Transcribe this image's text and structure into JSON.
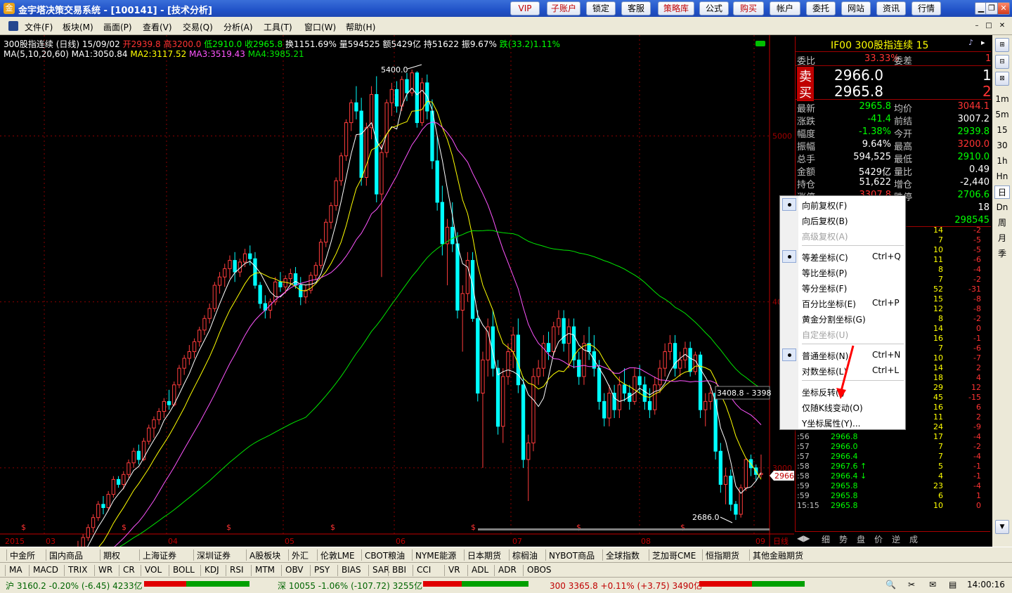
{
  "window": {
    "title": "金宇塔决策交易系统 - [100141] - [技术分析]",
    "title_buttons": [
      "VIP",
      "子账户",
      "锁定",
      "客服",
      "策略库",
      "公式",
      "购买",
      "帐户",
      "委托",
      "网站",
      "资讯",
      "行情"
    ]
  },
  "menubar": [
    "文件(F)",
    "板块(M)",
    "画面(P)",
    "查看(V)",
    "交易(Q)",
    "分析(A)",
    "工具(T)",
    "窗口(W)",
    "帮助(H)"
  ],
  "info": {
    "name": "300股指连续 (日线) 15/09/02",
    "open": "开2939.8",
    "high": "高3200.0",
    "low": "低2910.0",
    "close": "收2965.8",
    "turnover": "换1151.69%",
    "volume": "量594525",
    "amount": "额5429亿",
    "position": "持51622",
    "amplitude": "振9.67%",
    "change": "跌(33.2)1.11%",
    "ma_label": "MA(5,10,20,60)",
    "ma1": "MA1:3050.84",
    "ma2": "MA2:3117.52",
    "ma3": "MA3:3519.43",
    "ma4": "MA4:3985.21"
  },
  "chart_data": {
    "type": "candlestick",
    "y_ticks": [
      5000,
      4000,
      3000
    ],
    "x_labels": [
      "2015",
      "03",
      "04",
      "05",
      "06",
      "07",
      "08",
      "09"
    ],
    "annotations": {
      "peak": "5400.0",
      "trough": "2686.0",
      "crosshair_label": "3408.8 - 3398",
      "last_price": "2966",
      "axis_mode": "日线"
    },
    "ohlc": [
      [
        2320,
        2375,
        2295,
        2340
      ],
      [
        2340,
        2390,
        2310,
        2355
      ],
      [
        2355,
        2375,
        2300,
        2330
      ],
      [
        2330,
        2405,
        2310,
        2380
      ],
      [
        2380,
        2430,
        2350,
        2370
      ],
      [
        2370,
        2420,
        2330,
        2395
      ],
      [
        2395,
        2460,
        2380,
        2440
      ],
      [
        2440,
        2450,
        2360,
        2380
      ],
      [
        2380,
        2410,
        2320,
        2350
      ],
      [
        2350,
        2400,
        2310,
        2390
      ],
      [
        2390,
        2420,
        2300,
        2320
      ],
      [
        2320,
        2360,
        2290,
        2350
      ],
      [
        2350,
        2430,
        2340,
        2410
      ],
      [
        2410,
        2520,
        2400,
        2500
      ],
      [
        2500,
        2560,
        2470,
        2520
      ],
      [
        2520,
        2600,
        2500,
        2580
      ],
      [
        2580,
        2660,
        2560,
        2640
      ],
      [
        2640,
        2720,
        2610,
        2700
      ],
      [
        2700,
        2800,
        2680,
        2780
      ],
      [
        2780,
        2830,
        2720,
        2760
      ],
      [
        2760,
        2860,
        2740,
        2840
      ],
      [
        2840,
        2950,
        2820,
        2930
      ],
      [
        2930,
        2950,
        2880,
        2900
      ],
      [
        2900,
        2980,
        2870,
        2960
      ],
      [
        2960,
        3050,
        2940,
        3030
      ],
      [
        3030,
        3120,
        3000,
        3100
      ],
      [
        3100,
        3140,
        3020,
        3050
      ],
      [
        3050,
        3180,
        3040,
        3160
      ],
      [
        3160,
        3260,
        3140,
        3240
      ],
      [
        3240,
        3310,
        3180,
        3290
      ],
      [
        3290,
        3360,
        3260,
        3340
      ],
      [
        3340,
        3420,
        3300,
        3400
      ],
      [
        3400,
        3470,
        3350,
        3380
      ],
      [
        3380,
        3520,
        3370,
        3500
      ],
      [
        3500,
        3620,
        3480,
        3600
      ],
      [
        3600,
        3680,
        3560,
        3660
      ],
      [
        3660,
        3740,
        3620,
        3700
      ],
      [
        3700,
        3780,
        3660,
        3760
      ],
      [
        3760,
        3850,
        3730,
        3830
      ],
      [
        3830,
        3920,
        3800,
        3900
      ],
      [
        3900,
        3990,
        3870,
        3960
      ],
      [
        3960,
        4120,
        3940,
        4100
      ],
      [
        4100,
        4180,
        4050,
        4150
      ],
      [
        4150,
        4230,
        4090,
        4200
      ],
      [
        4200,
        4280,
        4140,
        4250
      ],
      [
        4250,
        4300,
        4120,
        4180
      ],
      [
        4180,
        4260,
        4150,
        4240
      ],
      [
        4240,
        4320,
        4210,
        4290
      ],
      [
        4290,
        4340,
        4220,
        4260
      ],
      [
        4260,
        4300,
        4080,
        4100
      ],
      [
        4100,
        4120,
        3960,
        3990
      ],
      [
        3990,
        4040,
        3900,
        3950
      ],
      [
        3950,
        4020,
        3900,
        4000
      ],
      [
        4000,
        4150,
        3980,
        4120
      ],
      [
        4120,
        4180,
        4060,
        4090
      ],
      [
        4090,
        4160,
        4050,
        4140
      ],
      [
        4140,
        4200,
        4100,
        4170
      ],
      [
        4170,
        4210,
        4080,
        4100
      ],
      [
        4100,
        4150,
        3980,
        4030
      ],
      [
        4030,
        4100,
        3990,
        4070
      ],
      [
        4070,
        4180,
        4050,
        4160
      ],
      [
        4160,
        4240,
        4130,
        4220
      ],
      [
        4220,
        4380,
        4200,
        4360
      ],
      [
        4360,
        4500,
        4330,
        4480
      ],
      [
        4480,
        4600,
        4440,
        4580
      ],
      [
        4580,
        4750,
        4550,
        4730
      ],
      [
        4730,
        4900,
        4700,
        4880
      ],
      [
        4880,
        5100,
        4850,
        5080
      ],
      [
        5080,
        5220,
        5030,
        5200
      ],
      [
        5200,
        5300,
        5100,
        5150
      ],
      [
        5150,
        5230,
        4700,
        4750
      ],
      [
        4750,
        5080,
        4700,
        5050
      ],
      [
        5050,
        5300,
        4980,
        5250
      ],
      [
        5250,
        5360,
        4600,
        4650
      ],
      [
        4650,
        4950,
        4150,
        4900
      ],
      [
        4900,
        5220,
        4870,
        5200
      ],
      [
        5200,
        5320,
        5120,
        5280
      ],
      [
        5280,
        5330,
        5140,
        5180
      ],
      [
        5180,
        5360,
        5150,
        5340
      ],
      [
        5340,
        5380,
        5210,
        5260
      ],
      [
        5260,
        5400,
        5240,
        5380
      ],
      [
        5380,
        5390,
        5050,
        5080
      ],
      [
        5080,
        5350,
        5060,
        5320
      ],
      [
        5320,
        5370,
        5100,
        5150
      ],
      [
        5150,
        5220,
        4800,
        4850
      ],
      [
        4850,
        5000,
        4550,
        4600
      ],
      [
        4600,
        4700,
        4280,
        4350
      ],
      [
        4350,
        4500,
        4100,
        4450
      ],
      [
        4450,
        4600,
        4300,
        4350
      ],
      [
        4350,
        4420,
        3900,
        3950
      ],
      [
        3950,
        4100,
        3700,
        4050
      ],
      [
        4050,
        4300,
        4000,
        4250
      ],
      [
        4250,
        4300,
        3880,
        3900
      ],
      [
        3900,
        3950,
        3400,
        3450
      ],
      [
        3450,
        3700,
        3000,
        3650
      ],
      [
        3650,
        3900,
        3550,
        3850
      ],
      [
        3850,
        3950,
        3550,
        3600
      ],
      [
        3600,
        3650,
        3200,
        3250
      ],
      [
        3250,
        3600,
        3150,
        3550
      ],
      [
        3550,
        3750,
        3500,
        3700
      ],
      [
        3700,
        3850,
        3600,
        3800
      ],
      [
        3800,
        3900,
        3450,
        3500
      ],
      [
        3500,
        3550,
        3000,
        3050
      ],
      [
        3050,
        3200,
        2800,
        3150
      ],
      [
        3150,
        3600,
        3100,
        3550
      ],
      [
        3550,
        3650,
        3500,
        3600
      ],
      [
        3600,
        3800,
        3550,
        3750
      ],
      [
        3750,
        3820,
        3650,
        3700
      ],
      [
        3700,
        3880,
        3680,
        3850
      ],
      [
        3850,
        3950,
        3800,
        3900
      ],
      [
        3900,
        3950,
        3700,
        3750
      ],
      [
        3750,
        3900,
        3600,
        3850
      ],
      [
        3850,
        3900,
        3600,
        3650
      ],
      [
        3650,
        3700,
        3500,
        3550
      ],
      [
        3550,
        3800,
        3500,
        3750
      ],
      [
        3750,
        3850,
        3650,
        3700
      ],
      [
        3700,
        3800,
        3550,
        3600
      ],
      [
        3600,
        3650,
        3350,
        3400
      ],
      [
        3400,
        3450,
        3250,
        3300
      ],
      [
        3300,
        3500,
        3250,
        3450
      ],
      [
        3450,
        3500,
        3300,
        3350
      ],
      [
        3350,
        3550,
        3300,
        3500
      ],
      [
        3500,
        3600,
        3400,
        3450
      ],
      [
        3450,
        3500,
        3350,
        3400
      ],
      [
        3400,
        3600,
        3380,
        3550
      ],
      [
        3550,
        3620,
        3450,
        3500
      ],
      [
        3500,
        3550,
        3350,
        3400
      ],
      [
        3400,
        3480,
        3300,
        3350
      ],
      [
        3350,
        3550,
        3320,
        3500
      ],
      [
        3500,
        3650,
        3450,
        3600
      ],
      [
        3600,
        3750,
        3550,
        3700
      ],
      [
        3700,
        3800,
        3650,
        3750
      ],
      [
        3750,
        3800,
        3550,
        3600
      ],
      [
        3600,
        3700,
        3550,
        3650
      ],
      [
        3650,
        3760,
        3600,
        3720
      ],
      [
        3720,
        3760,
        3550,
        3580
      ],
      [
        3580,
        3700,
        3560,
        3680
      ],
      [
        3680,
        3700,
        3300,
        3350
      ],
      [
        3350,
        3450,
        3250,
        3400
      ],
      [
        3400,
        3500,
        3350,
        3450
      ],
      [
        3450,
        3480,
        3050,
        3100
      ],
      [
        3100,
        3150,
        2850,
        2900
      ],
      [
        2900,
        3000,
        2780,
        2950
      ],
      [
        2950,
        2990,
        2740,
        2780
      ],
      [
        2780,
        2800,
        2686,
        2720
      ],
      [
        2720,
        2900,
        2700,
        2880
      ],
      [
        2880,
        3060,
        2860,
        3050
      ],
      [
        3050,
        3080,
        2950,
        3000
      ],
      [
        3000,
        3020,
        2920,
        2960
      ],
      [
        2960,
        3080,
        2940,
        2966
      ]
    ],
    "ma_colors": {
      "ma1": "#ffffff",
      "ma2": "#ffff00",
      "ma3": "#ff55ff",
      "ma4": "#00e600"
    }
  },
  "quote": {
    "header": "IF00  300股指连续  15",
    "weibi_label": "委比",
    "weibi": "33.33%",
    "weicha_label": "委差",
    "weicha": "1",
    "sell_label": "卖",
    "sell_price": "2966.0",
    "sell_vol": "1",
    "buy_label": "买",
    "buy_price": "2965.8",
    "buy_vol": "2",
    "rows": [
      {
        "l1": "最新",
        "v1": "2965.8",
        "c1": "#00ff00",
        "l2": "均价",
        "v2": "3044.1",
        "c2": "#ff3333"
      },
      {
        "l1": "涨跌",
        "v1": "-41.4",
        "c1": "#00ff00",
        "l2": "前结",
        "v2": "3007.2",
        "c2": "#ffffff"
      },
      {
        "l1": "幅度",
        "v1": "-1.38%",
        "c1": "#00ff00",
        "l2": "今开",
        "v2": "2939.8",
        "c2": "#00ff00"
      },
      {
        "l1": "振幅",
        "v1": "9.64%",
        "c1": "#ffffff",
        "l2": "最高",
        "v2": "3200.0",
        "c2": "#ff3333"
      },
      {
        "l1": "总手",
        "v1": "594,525",
        "c1": "#ffffff",
        "l2": "最低",
        "v2": "2910.0",
        "c2": "#00ff00"
      },
      {
        "l1": "金额",
        "v1": "5429亿",
        "c1": "#ffffff",
        "l2": "量比",
        "v2": "0.49",
        "c2": "#ffffff"
      },
      {
        "l1": "持仓",
        "v1": "51,622",
        "c1": "#ffffff",
        "l2": "增仓",
        "v2": "-2,440",
        "c2": "#ffffff"
      },
      {
        "l1": "涨停",
        "v1": "3307.8",
        "c1": "#ff3333",
        "l2": "跌停",
        "v2": "2706.6",
        "c2": "#00ff00"
      },
      {
        "l1": "",
        "v1": "",
        "c1": "#ffffff",
        "l2": "量",
        "v2": "18",
        "c2": "#ffffff"
      },
      {
        "l1": "",
        "v1": "",
        "c1": "#ffffff",
        "l2": "盘",
        "v2": "298545",
        "c2": "#00ff00"
      }
    ],
    "ticks": [
      {
        "t": "",
        "p": "",
        "vol": "14",
        "diff": "-2"
      },
      {
        "t": "",
        "p": "",
        "vol": "7",
        "diff": "-5"
      },
      {
        "t": "",
        "p": "",
        "vol": "10",
        "diff": "-5"
      },
      {
        "t": "",
        "p": "",
        "vol": "11",
        "diff": "-6"
      },
      {
        "t": "",
        "p": "",
        "vol": "8",
        "diff": "-4"
      },
      {
        "t": "",
        "p": "",
        "vol": "7",
        "diff": "-2"
      },
      {
        "t": "",
        "p": "",
        "vol": "52",
        "diff": "-31"
      },
      {
        "t": "",
        "p": "",
        "vol": "15",
        "diff": "-8"
      },
      {
        "t": "",
        "p": "",
        "vol": "12",
        "diff": "-8"
      },
      {
        "t": "",
        "p": "",
        "vol": "8",
        "diff": "-2"
      },
      {
        "t": "",
        "p": "",
        "vol": "14",
        "diff": "0"
      },
      {
        "t": "",
        "p": "",
        "vol": "16",
        "diff": "-1"
      },
      {
        "t": "",
        "p": "",
        "vol": "7",
        "diff": "-6"
      },
      {
        "t": "",
        "p": "",
        "vol": "10",
        "diff": "-7"
      },
      {
        "t": "",
        "p": "",
        "vol": "14",
        "diff": "2"
      },
      {
        "t": "",
        "p": "",
        "vol": "18",
        "diff": "4"
      },
      {
        "t": "",
        "p": "",
        "vol": "29",
        "diff": "12"
      },
      {
        "t": "",
        "p": "",
        "vol": "45",
        "diff": "-15"
      },
      {
        "t": "",
        "p": "",
        "vol": "16",
        "diff": "6"
      },
      {
        "t": "",
        "p": "",
        "vol": "11",
        "diff": "2"
      },
      {
        "t": ":56",
        "p": "2966.6",
        "vol": "24",
        "diff": "-9"
      },
      {
        "t": ":56",
        "p": "2966.8",
        "vol": "17",
        "diff": "-4"
      },
      {
        "t": ":57",
        "p": "2966.0",
        "vol": "7",
        "diff": "-2"
      },
      {
        "t": ":57",
        "p": "2966.4",
        "vol": "7",
        "diff": "-4"
      },
      {
        "t": ":58",
        "p": "2967.6 ↑",
        "vol": "5",
        "diff": "-1"
      },
      {
        "t": ":58",
        "p": "2966.4 ↓",
        "vol": "4",
        "diff": "-1"
      },
      {
        "t": ":59",
        "p": "2965.8",
        "vol": "23",
        "diff": "-4"
      },
      {
        "t": ":59",
        "p": "2965.8",
        "vol": "6",
        "diff": "1"
      },
      {
        "t": "15:15",
        "p": "2965.8",
        "vol": "10",
        "diff": "0"
      }
    ]
  },
  "context_menu": [
    {
      "label": "向前复权(F)",
      "shortcut": "",
      "checked": true,
      "disabled": false
    },
    {
      "label": "向后复权(B)",
      "shortcut": "",
      "checked": false,
      "disabled": false
    },
    {
      "label": "高级复权(A)",
      "shortcut": "",
      "checked": false,
      "disabled": true
    },
    {
      "sep": true
    },
    {
      "label": "等差坐标(C)",
      "shortcut": "Ctrl+Q",
      "checked": true,
      "disabled": false
    },
    {
      "label": "等比坐标(P)",
      "shortcut": "",
      "checked": false,
      "disabled": false
    },
    {
      "label": "等分坐标(F)",
      "shortcut": "",
      "checked": false,
      "disabled": false
    },
    {
      "label": "百分比坐标(E)",
      "shortcut": "Ctrl+P",
      "checked": false,
      "disabled": false
    },
    {
      "label": "黄金分割坐标(G)",
      "shortcut": "",
      "checked": false,
      "disabled": false
    },
    {
      "label": "自定坐标(U)",
      "shortcut": "",
      "checked": false,
      "disabled": true
    },
    {
      "sep": true
    },
    {
      "label": "普通坐标(N)",
      "shortcut": "Ctrl+N",
      "checked": true,
      "disabled": false
    },
    {
      "label": "对数坐标(L)",
      "shortcut": "Ctrl+L",
      "checked": false,
      "disabled": false
    },
    {
      "sep": true
    },
    {
      "label": "坐标反转(I)",
      "shortcut": "",
      "checked": false,
      "disabled": false
    },
    {
      "label": "仅随K线变动(O)",
      "shortcut": "",
      "checked": false,
      "disabled": false
    },
    {
      "label": "Y坐标属性(Y)...",
      "shortcut": "",
      "checked": false,
      "disabled": false
    }
  ],
  "right_toolbar": [
    "1m",
    "5m",
    "15",
    "30",
    "1h",
    "Hn",
    "日",
    "Dn",
    "周",
    "月",
    "季"
  ],
  "right_tabs": [
    "细",
    "势",
    "盘",
    "价",
    "逆",
    "成"
  ],
  "market_tabs": [
    "中金所",
    "国内商品",
    "期权",
    "上海证券",
    "深圳证券",
    "A股板块",
    "外汇",
    "伦敦LME",
    "CBOT粮油",
    "NYME能源",
    "日本期货",
    "棕榈油",
    "NYBOT商品",
    "全球指数",
    "芝加哥CME",
    "恒指期货",
    "其他金融期货"
  ],
  "indicators": [
    "MA",
    "MACD",
    "TRIX",
    "WR",
    "CR",
    "VOL",
    "BOLL",
    "KDJ",
    "RSI",
    "MTM",
    "OBV",
    "PSY",
    "BIAS",
    "SAR",
    "BBI",
    "CCI",
    "VR",
    "ADL",
    "ADR",
    "OBOS"
  ],
  "status": {
    "sh": "沪 3160.2 -0.20% (-6.45) 4233亿",
    "sz": "深 10055 -1.06% (-107.72) 3255亿",
    "c300": "300 3365.8 +0.11% (+3.75) 3490亿",
    "time": "14:00:16"
  }
}
